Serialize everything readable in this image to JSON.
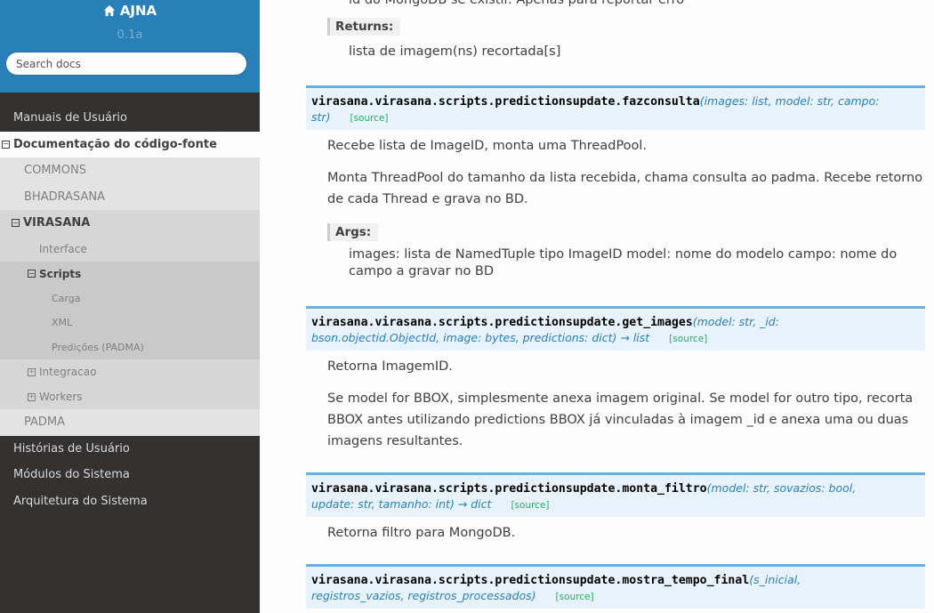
{
  "sidebar": {
    "brand": "AJNA",
    "version": "0.1a",
    "search_placeholder": "Search docs",
    "items": {
      "manuais": "Manuais de Usuário",
      "documentacao": "Documentação do código-fonte",
      "commons": "COMMONS",
      "bhadrasana": "BHADRASANA",
      "virasana": "VIRASANA",
      "interface": "Interface",
      "scripts": "Scripts",
      "carga": "Carga",
      "xml": "XML",
      "predicoes": "Predições (PADMA)",
      "integracao": "Integracao",
      "workers": "Workers",
      "padma": "PADMA",
      "historias": "Histórias de Usuário",
      "modulos": "Módulos do Sistema",
      "arquitetura": "Arquitetura do Sistema"
    }
  },
  "content": {
    "top_partial": "id do MongoDB se existir. Apenas para reportar erro",
    "returns_label": "Returns:",
    "returns_text": "lista de imagem(ns) recortada[s]",
    "fn1": {
      "name": "virasana.virasana.scripts.predictionsupdate.fazconsulta",
      "open": "(",
      "params_line1": "images: list, model: str, campo:",
      "params_line2": "str",
      "close": ")",
      "source": "[source]",
      "desc1": "Recebe lista de ImageID, monta uma ThreadPool.",
      "desc2": "Monta ThreadPool do tamanho da lista recebida, chama consulta ao padma. Recebe retorno de cada Thread e grava no BD.",
      "args_label": "Args:",
      "args_text": "images: lista de NamedTuple tipo ImageID model: nome do modelo campo: nome do campo a gravar no BD"
    },
    "fn2": {
      "name": "virasana.virasana.scripts.predictionsupdate.get_images",
      "params_line1": "(model: str, _id:",
      "params_line2": "bson.objectid.ObjectId, image: bytes, predictions: dict) → list",
      "source": "[source]",
      "desc1": "Retorna ImagemID.",
      "desc2": "Se model for BBOX, simplesmente anexa imagem original. Se model for outro tipo, recorta BBOX antes utilizando predictions BBOX já vinculadas à imagem _id e anexa uma ou duas imagens resultantes."
    },
    "fn3": {
      "name": "virasana.virasana.scripts.predictionsupdate.monta_filtro",
      "params_line1": "(model: str, sovazios: bool,",
      "params_line2": "update: str, tamanho: int) → dict",
      "source": "[source]",
      "desc1": "Retorna filtro para MongoDB."
    },
    "fn4": {
      "name": "virasana.virasana.scripts.predictionsupdate.mostra_tempo_final",
      "params_line1": "(s_inicial,",
      "params_line2": "registros_vazios, registros_processados)",
      "source": "[source]"
    }
  },
  "colors": {
    "sidebar_bg": "#343131",
    "header_blue": "#2980b9",
    "sig_bg": "#e7f2fa",
    "sig_border": "#6ab0de",
    "source_green": "#27ae60"
  }
}
